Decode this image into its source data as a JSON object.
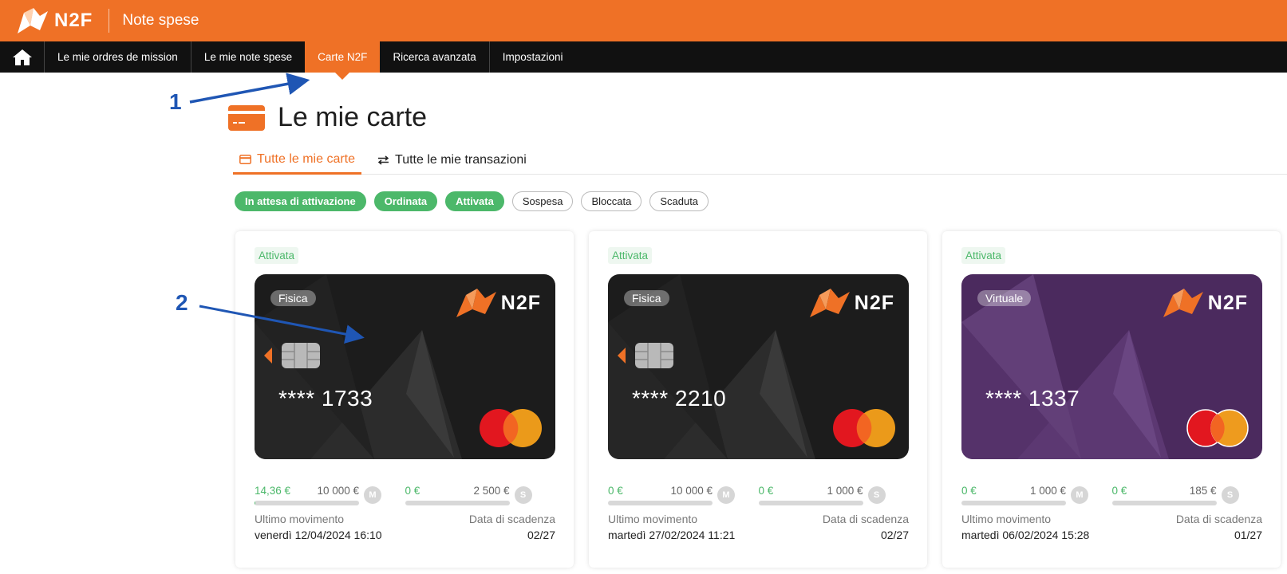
{
  "header": {
    "logo_text": "N2F",
    "app_title": "Note spese"
  },
  "nav": {
    "items": [
      {
        "label": "Le mie ordres de mission"
      },
      {
        "label": "Le mie note spese"
      },
      {
        "label": "Carte N2F"
      },
      {
        "label": "Ricerca avanzata"
      },
      {
        "label": "Impostazioni"
      }
    ]
  },
  "page": {
    "title": "Le mie carte"
  },
  "tabs": [
    {
      "label": "Tutte le mie carte"
    },
    {
      "label": "Tutte le mie transazioni"
    }
  ],
  "filters": [
    {
      "label": "In attesa di attivazione"
    },
    {
      "label": "Ordinata"
    },
    {
      "label": "Attivata"
    },
    {
      "label": "Sospesa"
    },
    {
      "label": "Bloccata"
    },
    {
      "label": "Scaduta"
    }
  ],
  "cards": [
    {
      "status": "Attivata",
      "type": "Fisica",
      "brand": "N2F",
      "number": "**** 1733",
      "monthly": {
        "used": "14,36 €",
        "max": "10 000 €",
        "badge": "M"
      },
      "other": {
        "used": "0 €",
        "max": "2 500 €",
        "badge": "S"
      },
      "last_label": "Ultimo movimento",
      "last_value": "venerdì 12/04/2024 16:10",
      "expiry_label": "Data di scadenza",
      "expiry_value": "02/27"
    },
    {
      "status": "Attivata",
      "type": "Fisica",
      "brand": "N2F",
      "number": "**** 2210",
      "monthly": {
        "used": "0 €",
        "max": "10 000 €",
        "badge": "M"
      },
      "other": {
        "used": "0 €",
        "max": "1 000 €",
        "badge": "S"
      },
      "last_label": "Ultimo movimento",
      "last_value": "martedì 27/02/2024 11:21",
      "expiry_label": "Data di scadenza",
      "expiry_value": "02/27"
    },
    {
      "status": "Attivata",
      "type": "Virtuale",
      "brand": "N2F",
      "number": "**** 1337",
      "monthly": {
        "used": "0 €",
        "max": "1 000 €",
        "badge": "M"
      },
      "other": {
        "used": "0 €",
        "max": "185 €",
        "badge": "S"
      },
      "last_label": "Ultimo movimento",
      "last_value": "martedì 06/02/2024 15:28",
      "expiry_label": "Data di scadenza",
      "expiry_value": "01/27"
    }
  ],
  "annotations": {
    "marker_1": "1",
    "marker_2": "2"
  },
  "colors": {
    "brand": "#ef7126",
    "nav": "#111111",
    "active_status": "#4cb86a",
    "card_dark": "#1c1c1c",
    "card_purple": "#4b2a5e"
  }
}
